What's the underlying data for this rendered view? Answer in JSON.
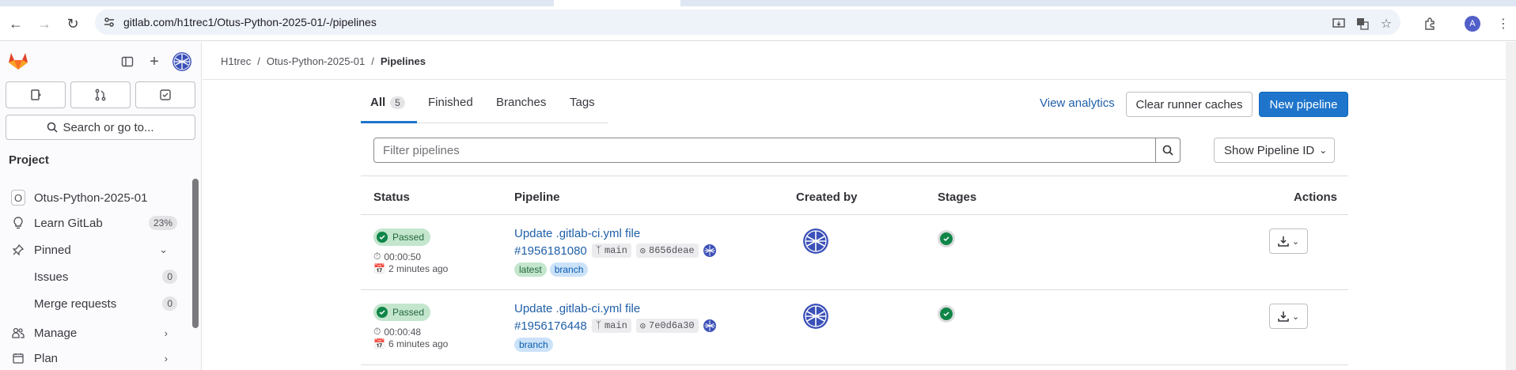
{
  "browser": {
    "url": "gitlab.com/h1trec1/Otus-Python-2025-01/-/pipelines",
    "profile_initial": "A"
  },
  "sidebar": {
    "search_label": "Search or go to...",
    "section_title": "Project",
    "items": [
      {
        "label": "Otus-Python-2025-01",
        "icon": "O"
      },
      {
        "label": "Learn GitLab",
        "badge": "23%"
      },
      {
        "label": "Pinned"
      },
      {
        "label": "Issues",
        "badge": "0"
      },
      {
        "label": "Merge requests",
        "badge": "0"
      },
      {
        "label": "Manage"
      },
      {
        "label": "Plan"
      }
    ]
  },
  "breadcrumb": [
    "H1trec",
    "Otus-Python-2025-01",
    "Pipelines"
  ],
  "tabs": [
    {
      "label": "All",
      "count": "5"
    },
    {
      "label": "Finished"
    },
    {
      "label": "Branches"
    },
    {
      "label": "Tags"
    }
  ],
  "header_actions": {
    "view_analytics": "View analytics",
    "clear_caches": "Clear runner caches",
    "new_pipeline": "New pipeline"
  },
  "filter": {
    "placeholder": "Filter pipelines",
    "show_id": "Show Pipeline ID"
  },
  "table": {
    "headers": [
      "Status",
      "Pipeline",
      "Created by",
      "Stages",
      "Actions"
    ],
    "rows": [
      {
        "status": "Passed",
        "duration": "00:00:50",
        "finished": "2 minutes ago",
        "title": "Update .gitlab-ci.yml file",
        "id": "#1956181080",
        "branch": "main",
        "commit": "8656deae",
        "tags": [
          "latest",
          "branch"
        ]
      },
      {
        "status": "Passed",
        "duration": "00:00:48",
        "finished": "6 minutes ago",
        "title": "Update .gitlab-ci.yml file",
        "id": "#1956176448",
        "branch": "main",
        "commit": "7e0d6a30",
        "tags": [
          "branch"
        ]
      }
    ]
  },
  "colors": {
    "primary": "#1f75cb",
    "success": "#108548",
    "link": "#1f5fa8"
  }
}
